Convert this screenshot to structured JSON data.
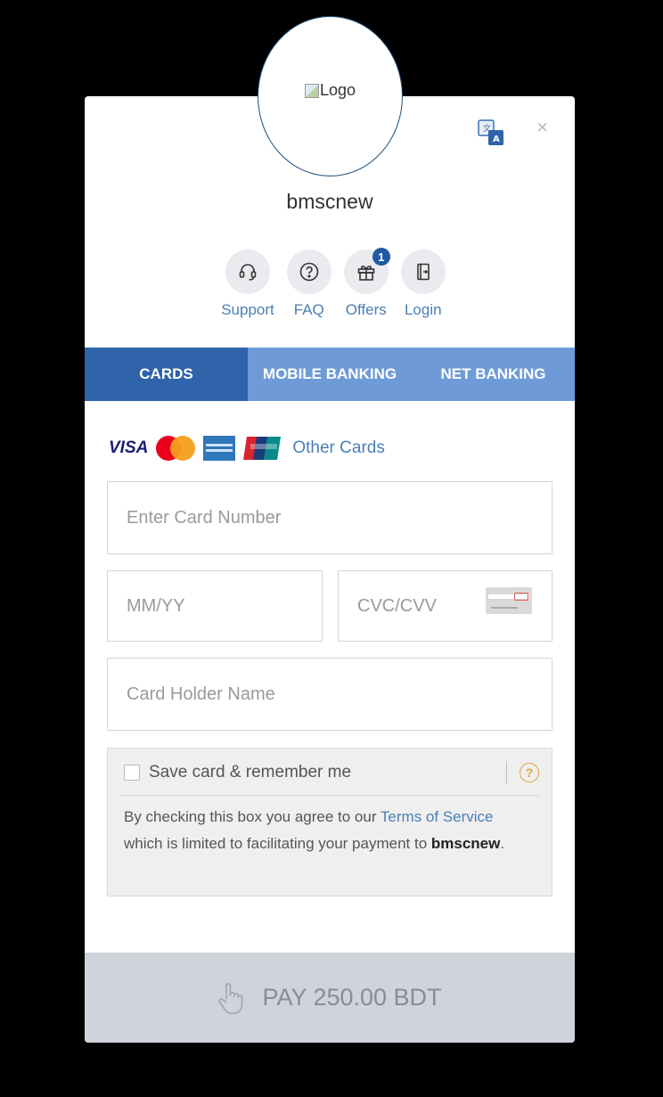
{
  "logo": {
    "alt_text": "Logo"
  },
  "merchant": {
    "name": "bmscnew"
  },
  "quick_links": [
    {
      "label": "Support",
      "icon": "headset-icon"
    },
    {
      "label": "FAQ",
      "icon": "question-icon"
    },
    {
      "label": "Offers",
      "icon": "gift-icon",
      "badge": "1"
    },
    {
      "label": "Login",
      "icon": "login-icon"
    }
  ],
  "tabs": [
    {
      "label": "CARDS",
      "active": true
    },
    {
      "label": "MOBILE BANKING",
      "active": false
    },
    {
      "label": "NET BANKING",
      "active": false
    }
  ],
  "card_brands": {
    "visa": "VISA",
    "other_cards": "Other Cards"
  },
  "form": {
    "card_number_placeholder": "Enter Card Number",
    "expiry_placeholder": "MM/YY",
    "cvc_placeholder": "CVC/CVV",
    "holder_placeholder": "Card Holder Name"
  },
  "save_card": {
    "label": "Save card & remember me",
    "help": "?",
    "text_before": "By checking this box you agree to our ",
    "terms_link": "Terms of Service",
    "text_middle": " which is limited to facilitating your payment to ",
    "merchant": "bmscnew",
    "text_end": "."
  },
  "pay_button": {
    "label": "PAY 250.00 BDT"
  },
  "colors": {
    "tab_active": "#2f63aa",
    "tab_inactive": "#6e9bd8",
    "link": "#4a7fb5",
    "pay_bar": "#cfd3da"
  }
}
